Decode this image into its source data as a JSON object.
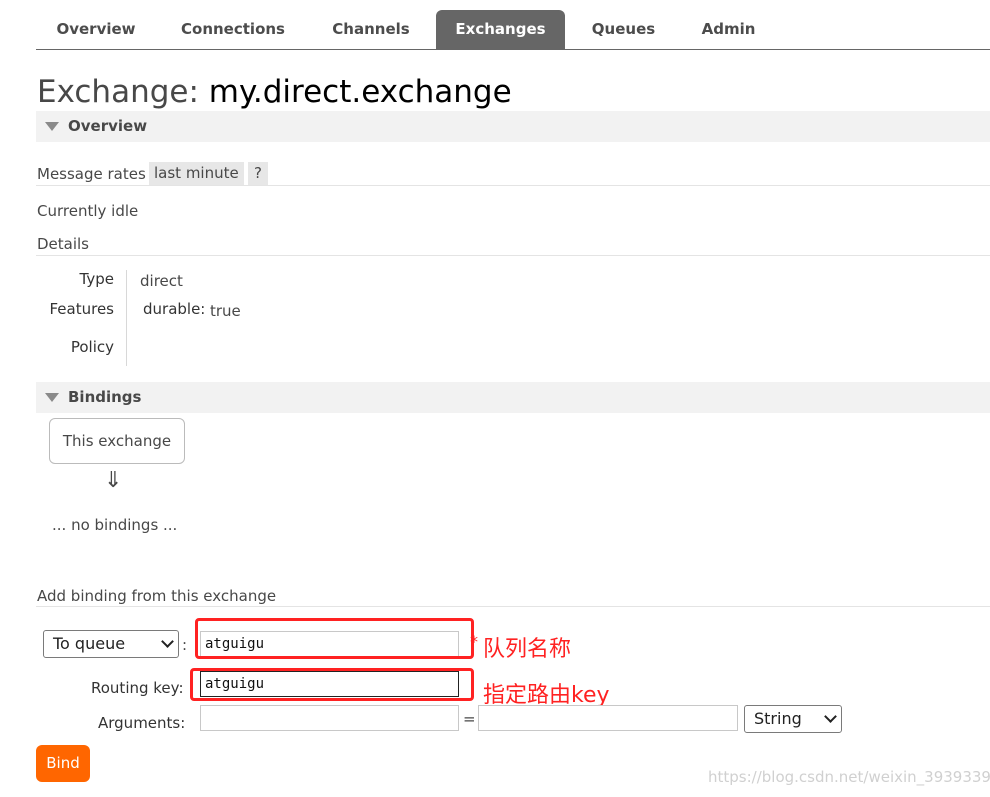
{
  "tabs": [
    {
      "label": "Overview"
    },
    {
      "label": "Connections"
    },
    {
      "label": "Channels"
    },
    {
      "label": "Exchanges",
      "active": true
    },
    {
      "label": "Queues"
    },
    {
      "label": "Admin"
    }
  ],
  "heading": {
    "prefix": "Exchange:",
    "name": "my.direct.exchange"
  },
  "overview": {
    "section_label": "Overview",
    "message_rates_label": "Message rates",
    "rate_period": "last minute",
    "help": "?",
    "status": "Currently idle",
    "details_label": "Details",
    "details": {
      "type_label": "Type",
      "type_value": "direct",
      "features_label": "Features",
      "feature_key": "durable:",
      "feature_value": "true",
      "policy_label": "Policy"
    }
  },
  "bindings": {
    "section_label": "Bindings",
    "this_exchange": "This exchange",
    "arrow": "⇓",
    "empty": "... no bindings ..."
  },
  "add_binding": {
    "title": "Add binding from this exchange",
    "destination_type": "To queue",
    "colon": ":",
    "destination_value": "atguigu",
    "routing_key_label": "Routing key:",
    "routing_key_value": "atguigu",
    "arguments_label": "Arguments:",
    "arguments_key": "",
    "equals": "=",
    "arguments_value": "",
    "arguments_type": "String",
    "bind_label": "Bind"
  },
  "annotations": {
    "queue_name": "队列名称",
    "routing_key": "指定路由key",
    "star": "*"
  },
  "watermark": "https://blog.csdn.net/weixin_39393393",
  "colors": {
    "accent": "#ff6600",
    "annotation": "#ff2222",
    "tab_active": "#666666"
  }
}
